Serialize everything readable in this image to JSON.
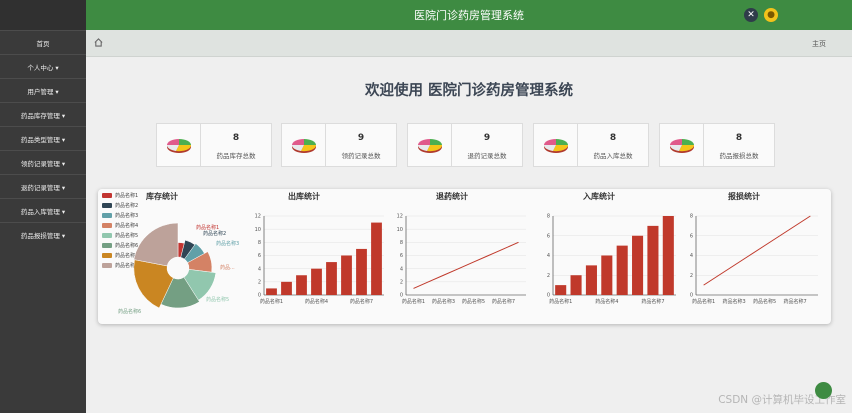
{
  "header": {
    "title": "医院门诊药房管理系统"
  },
  "sidebar": {
    "items": [
      {
        "label": "首页"
      },
      {
        "label": "个人中心 ▾"
      },
      {
        "label": "用户管理 ▾"
      },
      {
        "label": "药品库存管理 ▾"
      },
      {
        "label": "药品类型管理 ▾"
      },
      {
        "label": "领药记录管理 ▾"
      },
      {
        "label": "退药记录管理 ▾"
      },
      {
        "label": "药品入库管理 ▾"
      },
      {
        "label": "药品报损管理 ▾"
      }
    ]
  },
  "breadcrumb": {
    "right": "主页"
  },
  "welcome": "欢迎使用 医院门诊药房管理系统",
  "cards": [
    {
      "value": "8",
      "label": "药品库存总数"
    },
    {
      "value": "9",
      "label": "领药记录总数"
    },
    {
      "value": "9",
      "label": "退药记录总数"
    },
    {
      "value": "8",
      "label": "药品入库总数"
    },
    {
      "value": "8",
      "label": "药品报损总数"
    }
  ],
  "colors": {
    "header": "#3e8b42",
    "bar": "#c0392b",
    "line": "#c0392b"
  },
  "watermark": "CSDN @计算机毕设工作室",
  "chart_data": [
    {
      "type": "pie",
      "title": "库存统计",
      "legend": [
        "药品名称1",
        "药品名称2",
        "药品名称3",
        "药品名称4",
        "药品名称5",
        "药品名称6",
        "药品名称7",
        "药品名称8"
      ],
      "slice_labels": [
        "药品名称1",
        "药品名称2",
        "药品名称3",
        "药品...",
        "药品名称5",
        "药品名称6"
      ],
      "values": [
        4,
        6,
        7,
        10,
        14,
        16,
        21,
        22
      ],
      "colors": [
        "#c23531",
        "#2f4554",
        "#61a0a8",
        "#d48265",
        "#91c7ae",
        "#749f83",
        "#ca8622",
        "#bda29a"
      ]
    },
    {
      "type": "bar",
      "title": "出库统计",
      "categories": [
        "药品名称1",
        "药品名称2",
        "药品名称3",
        "药品名称4",
        "药品名称5",
        "药品名称6",
        "药品名称7",
        "药品名称8"
      ],
      "tick_labels": [
        "药品名称1",
        "药品名称4",
        "药品名称7"
      ],
      "values": [
        1,
        2,
        3,
        4,
        5,
        6,
        7,
        11
      ],
      "ylim": [
        0,
        12
      ],
      "yticks": [
        0,
        2,
        4,
        6,
        8,
        10,
        12
      ]
    },
    {
      "type": "line",
      "title": "退药统计",
      "categories": [
        "药品名称1",
        "药品名称2",
        "药品名称3",
        "药品名称4",
        "药品名称5",
        "药品名称6",
        "药品名称7",
        "药品名称8"
      ],
      "tick_labels": [
        "药品名称1",
        "药品名称3",
        "药品名称5",
        "药品名称7"
      ],
      "values": [
        1,
        2,
        3,
        4,
        5,
        6,
        7,
        8
      ],
      "ylim": [
        0,
        12
      ],
      "yticks": [
        0,
        2,
        4,
        6,
        8,
        10,
        12
      ]
    },
    {
      "type": "bar",
      "title": "入库统计",
      "categories": [
        "药品名称1",
        "药品名称2",
        "药品名称3",
        "药品名称4",
        "药品名称5",
        "药品名称6",
        "药品名称7",
        "药品名称8"
      ],
      "tick_labels": [
        "药品名称1",
        "药品名称4",
        "药品名称7"
      ],
      "values": [
        1,
        2,
        3,
        4,
        5,
        6,
        7,
        8
      ],
      "ylim": [
        0,
        8
      ],
      "yticks": [
        0,
        2,
        4,
        6,
        8
      ]
    },
    {
      "type": "line",
      "title": "报损统计",
      "categories": [
        "药品名称1",
        "药品名称2",
        "药品名称3",
        "药品名称4",
        "药品名称5",
        "药品名称6",
        "药品名称7",
        "药品名称8"
      ],
      "tick_labels": [
        "药品名称1",
        "药品名称3",
        "药品名称5",
        "药品名称7"
      ],
      "values": [
        1,
        2,
        3,
        4,
        5,
        6,
        7,
        8
      ],
      "ylim": [
        0,
        8
      ],
      "yticks": [
        0,
        2,
        4,
        6,
        8
      ]
    }
  ]
}
